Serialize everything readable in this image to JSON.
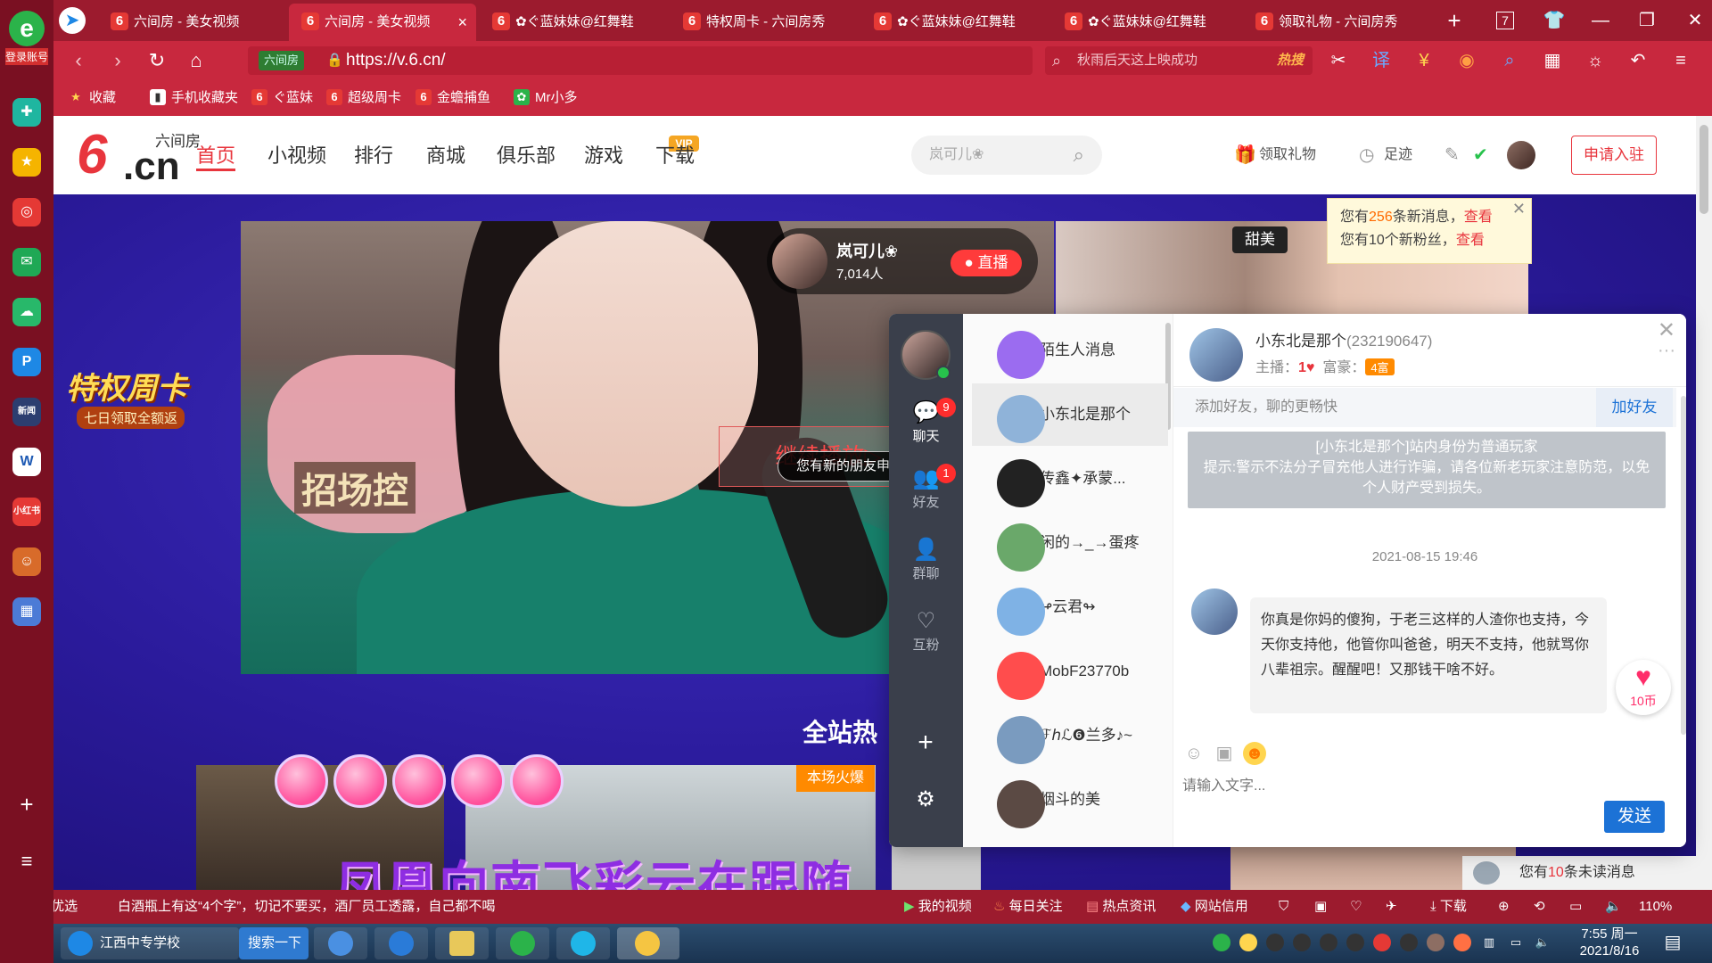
{
  "browser": {
    "tabs": [
      {
        "label": "六间房 - 美女视频",
        "active": false
      },
      {
        "label": "六间房 - 美女视频",
        "active": true
      },
      {
        "label": "✿ぐ蓝妹妹@红舞鞋",
        "active": false
      },
      {
        "label": "特权周卡 - 六间房秀",
        "active": false
      },
      {
        "label": "✿ぐ蓝妹妹@红舞鞋",
        "active": false
      },
      {
        "label": "✿ぐ蓝妹妹@红舞鞋",
        "active": false
      },
      {
        "label": "领取礼物 - 六间房秀",
        "active": false
      }
    ],
    "login_label": "登录账号",
    "tab_count": "7",
    "url": "https://v.6.cn/",
    "secure_label": "六间房",
    "search_placeholder": "秋雨后天这上映成功",
    "search_hot": "热搜",
    "bookmarks": [
      "收藏",
      "手机收藏夹",
      "ぐ蓝妹",
      "超级周卡",
      "金蟾捕鱼",
      "Mr小多"
    ],
    "accent": "#c8283e"
  },
  "site": {
    "logo_name": "六间房",
    "logo_domain": ".cn",
    "nav": [
      "首页",
      "小视频",
      "排行",
      "商城",
      "俱乐部",
      "游戏",
      "下载"
    ],
    "vip_tag": "VIP",
    "search_placeholder": "岚可儿❀",
    "gift_link": "领取礼物",
    "footprint_link": "足迹",
    "apply_button": "申请入驻",
    "brand_color": "#e8353d"
  },
  "notice": {
    "line1_prefix": "您有",
    "line1_count": "256",
    "line1_suffix": "条新消息，",
    "line1_link": "查看",
    "line2_prefix": "您有10个新粉丝，",
    "line2_link": "查看"
  },
  "promo": {
    "title": "特权周卡",
    "subtitle": "七日领取全额返"
  },
  "stream": {
    "streamer": "岚可儿❀",
    "viewers": "7,014人",
    "live_label": "● 直播",
    "resume_label": "继续播放▷",
    "sign_text": "招场控",
    "friend_toast": "您有新的朋友申请",
    "side_tag": "甜美"
  },
  "section_title": "全站热",
  "hot_tag": "本场火爆",
  "banner_text": "凤凰向南飞彩云在跟随",
  "unread": {
    "prefix": "您有",
    "count": "10",
    "suffix": "条未读消息"
  },
  "chat": {
    "rail": [
      {
        "label": "聊天",
        "badge": "9",
        "icon": "chat-icon"
      },
      {
        "label": "好友",
        "badge": "1",
        "icon": "friends-icon"
      },
      {
        "label": "群聊",
        "badge": "",
        "icon": "group-icon"
      },
      {
        "label": "互粉",
        "badge": "",
        "icon": "mutual-icon"
      }
    ],
    "contacts": [
      {
        "name": "陌生人消息",
        "color": "#9b6cf0",
        "active": false
      },
      {
        "name": "小东北是那个",
        "color": "#8fb3d9",
        "active": true
      },
      {
        "name": "传鑫✦承蒙...",
        "color": "#222222",
        "active": false
      },
      {
        "name": "闲的→_→蛋疼",
        "color": "#6aa86a",
        "active": false
      },
      {
        "name": "↫云君↬",
        "color": "#7fb2e5",
        "active": false
      },
      {
        "name": "MobF23770b",
        "color": "#ff4d4d",
        "active": false
      },
      {
        "name": "ℱℎℒ❻兰多♪~",
        "color": "#7a9bbf",
        "active": false
      },
      {
        "name": "烟斗的美",
        "color": "#5b4a44",
        "active": false
      }
    ],
    "peer_name": "小东北是那个",
    "peer_id": "(232190647)",
    "peer_level_label": "主播：",
    "peer_level_value": "1♥",
    "peer_rich_label": "富豪：",
    "peer_rich_value": "4富",
    "add_friend_hint": "添加好友，聊的更畅快",
    "add_friend_button": "加好友",
    "system_tip": "[小东北是那个]站内身份为普通玩家\n提示:警示不法分子冒充他人进行诈骗，请各位新老玩家注意防范，以免个人财产受到损失。",
    "message_time": "2021-08-15 19:46",
    "message_text": "你真是你妈的傻狗，于老三这样的人渣你也支持，今天你支持他，他管你叫爸爸，明天不支持，他就骂你八辈祖宗。醒醒吧！又那钱干啥不好。",
    "gift_value": "10币",
    "input_placeholder": "请输入文字...",
    "send_button": "发送"
  },
  "statusbar": {
    "items": [
      "今日优选",
      "白酒瓶上有这“4个字”，切记不要买，酒厂员工透露，自己都不喝",
      "我的视频",
      "每日关注",
      "热点资讯",
      "网站信用",
      "下载",
      "110%"
    ]
  },
  "taskbar": {
    "items": [
      "江西中专学校",
      "搜索一下"
    ],
    "time": "7:55 周一",
    "date": "2021/8/16"
  }
}
